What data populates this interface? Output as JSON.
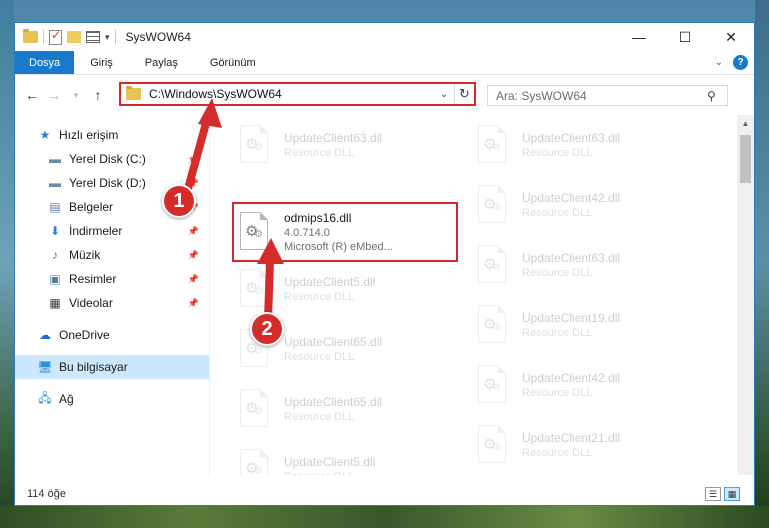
{
  "window": {
    "title": "SysWOW64"
  },
  "ribbon": {
    "tabs": [
      "Dosya",
      "Giriş",
      "Paylaş",
      "Görünüm"
    ]
  },
  "address": {
    "path": "C:\\Windows\\SysWOW64"
  },
  "search": {
    "placeholder": "Ara: SysWOW64"
  },
  "nav": {
    "quick_access": "Hızlı erişim",
    "items": [
      {
        "label": "Yerel Disk (C:)",
        "icon": "drive-icon"
      },
      {
        "label": "Yerel Disk (D:)",
        "icon": "drive-icon"
      },
      {
        "label": "Belgeler",
        "icon": "documents-icon"
      },
      {
        "label": "İndirmeler",
        "icon": "download-icon"
      },
      {
        "label": "Müzik",
        "icon": "music-icon"
      },
      {
        "label": "Resimler",
        "icon": "pictures-icon"
      },
      {
        "label": "Videolar",
        "icon": "videos-icon"
      }
    ],
    "onedrive": "OneDrive",
    "this_pc": "Bu bilgisayar",
    "network": "Ağ"
  },
  "files": {
    "highlighted": {
      "name": "odmips16.dll",
      "version": "4.0.714.0",
      "company": "Microsoft (R) eMbed..."
    },
    "col1": [
      {
        "name": "UpdateClient63.dll",
        "type": "Resource DLL"
      },
      {
        "name": "UpdateClient5.dll",
        "type": "Resource DLL"
      },
      {
        "name": "UpdateClient65.dll",
        "type": "Resource DLL"
      },
      {
        "name": "UpdateClient65.dll",
        "type": "Resource DLL"
      },
      {
        "name": "UpdateClient5.dll",
        "type": "Resource DLL"
      }
    ],
    "col2": [
      {
        "name": "UpdateClient63.dll",
        "type": "Resource DLL"
      },
      {
        "name": "UpdateClient42.dll",
        "type": "Resource DLL"
      },
      {
        "name": "UpdateClient63.dll",
        "type": "Resource DLL"
      },
      {
        "name": "UpdateClient19.dll",
        "type": "Resource DLL"
      },
      {
        "name": "UpdateClient42.dll",
        "type": "Resource DLL"
      },
      {
        "name": "UpdateClient21.dll",
        "type": "Resource DLL"
      }
    ]
  },
  "status": {
    "count": "114 öğe"
  },
  "callouts": {
    "one": "1",
    "two": "2"
  },
  "colors": {
    "accent": "#1979ca",
    "highlight": "#d32b2b"
  }
}
